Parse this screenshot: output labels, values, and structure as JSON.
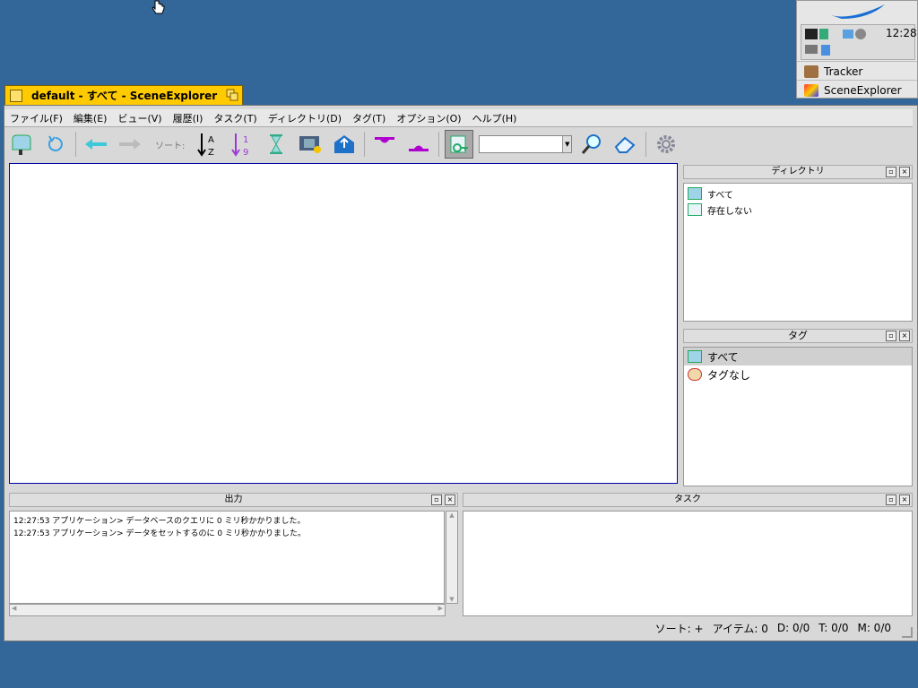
{
  "deskbar": {
    "clock": "12:28",
    "items": [
      {
        "label": "Tracker",
        "icon": "tracker-icon"
      },
      {
        "label": "SceneExplorer",
        "icon": "sceneexplorer-icon"
      }
    ]
  },
  "window": {
    "title": "default - すべて - SceneExplorer"
  },
  "menu": [
    "ファイル(F)",
    "編集(E)",
    "ビュー(V)",
    "履歴(I)",
    "タスク(T)",
    "ディレクトリ(D)",
    "タグ(T)",
    "オプション(O)",
    "ヘルプ(H)"
  ],
  "toolbar": {
    "sort_label": "ソート:",
    "search_value": ""
  },
  "directory_panel": {
    "title": "ディレクトリ",
    "items": [
      {
        "label": "すべて"
      },
      {
        "label": "存在しない"
      }
    ]
  },
  "tag_panel": {
    "title": "タグ",
    "items": [
      {
        "label": "すべて",
        "selected": true
      },
      {
        "label": "タグなし",
        "selected": false
      }
    ]
  },
  "output_panel": {
    "title": "出力",
    "lines": [
      "12:27:53 アプリケーション> データベースのクエリに 0 ミリ秒かかりました。",
      "12:27:53 アプリケーション> データをセットするのに 0 ミリ秒かかりました。"
    ]
  },
  "task_panel": {
    "title": "タスク"
  },
  "status": {
    "sort": "ソート: +",
    "items": "アイテム: 0",
    "d": "D: 0/0",
    "t": "T: 0/0",
    "m": "M: 0/0"
  },
  "colors": {
    "desktop": "#336699",
    "tab_active": "#ffcb00",
    "selection": "#d0d0d0"
  }
}
